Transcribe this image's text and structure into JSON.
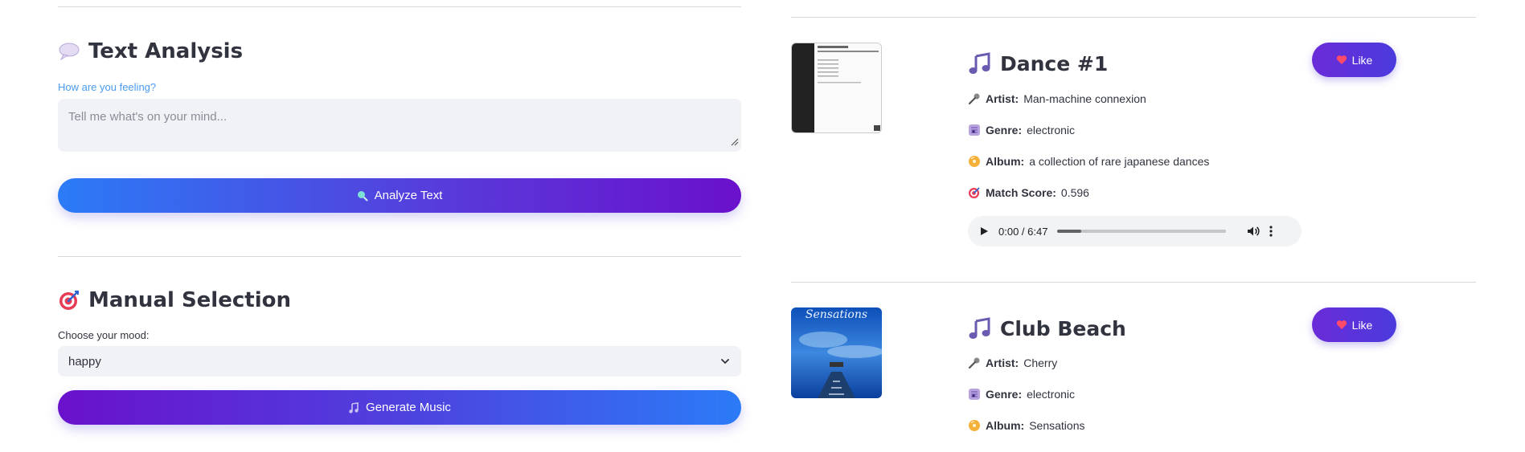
{
  "left": {
    "text_analysis": {
      "title": "Text Analysis",
      "label": "How are you feeling?",
      "placeholder": "Tell me what's on your mind...",
      "button": "Analyze Text"
    },
    "manual_selection": {
      "title": "Manual Selection",
      "label": "Choose your mood:",
      "selected": "happy",
      "button": "Generate Music"
    }
  },
  "tracks": [
    {
      "title": "Dance #1",
      "artist_label": "Artist:",
      "artist": "Man-machine connexion",
      "genre_label": "Genre:",
      "genre": "electronic",
      "album_label": "Album:",
      "album": "a collection of rare japanese dances",
      "score_label": "Match Score:",
      "score": "0.596",
      "like": "Like",
      "audio_time": "0:00 / 6:47",
      "audio_progress": 0.14
    },
    {
      "title": "Club Beach",
      "artist_label": "Artist:",
      "artist": "Cherry",
      "genre_label": "Genre:",
      "genre": "electronic",
      "album_label": "Album:",
      "album": "Sensations",
      "cover_text": "Sensations",
      "like": "Like"
    }
  ],
  "colors": {
    "accent_blue": "#2b7bf7",
    "accent_purple": "#6a11cb",
    "label_blue": "#4a9bf0"
  }
}
